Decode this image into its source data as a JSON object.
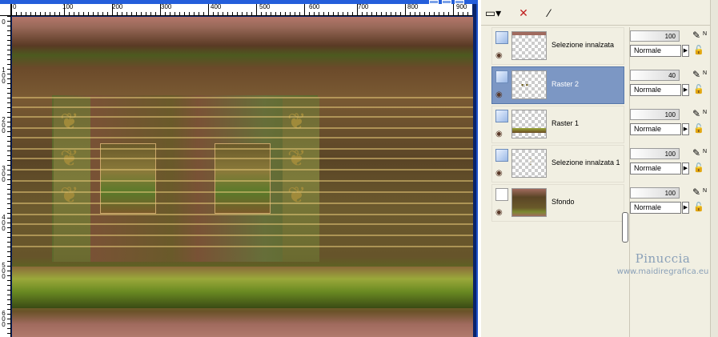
{
  "ruler": {
    "h_labels": [
      "0",
      "100",
      "200",
      "300",
      "400",
      "500",
      "600",
      "700",
      "800",
      "900"
    ],
    "v_labels": [
      "0",
      "1 0 0",
      "2 0 0",
      "3 0 0",
      "4 0 0",
      "5 0 0",
      "6 0 0"
    ]
  },
  "toolbar": {
    "buttons": [
      "new-layer",
      "delete-layer",
      "edit-selection"
    ]
  },
  "layers": [
    {
      "name": "Selezione innalzata",
      "opacity": "100",
      "blend": "Normale",
      "selected": false
    },
    {
      "name": "Raster 2",
      "opacity": "40",
      "blend": "Normale",
      "selected": true
    },
    {
      "name": "Raster 1",
      "opacity": "100",
      "blend": "Normale",
      "selected": false
    },
    {
      "name": "Selezione innalzata 1",
      "opacity": "100",
      "blend": "Normale",
      "selected": false
    },
    {
      "name": "Sfondo",
      "opacity": "100",
      "blend": "Normale",
      "selected": false
    }
  ],
  "watermark": {
    "line1": "Pinuccia",
    "line2": "www.maidiregrafica.eu"
  },
  "colors": {
    "selected_row": "#7c97c4",
    "panel_bg": "#f1efe2",
    "window_frame": "#0a246a"
  }
}
